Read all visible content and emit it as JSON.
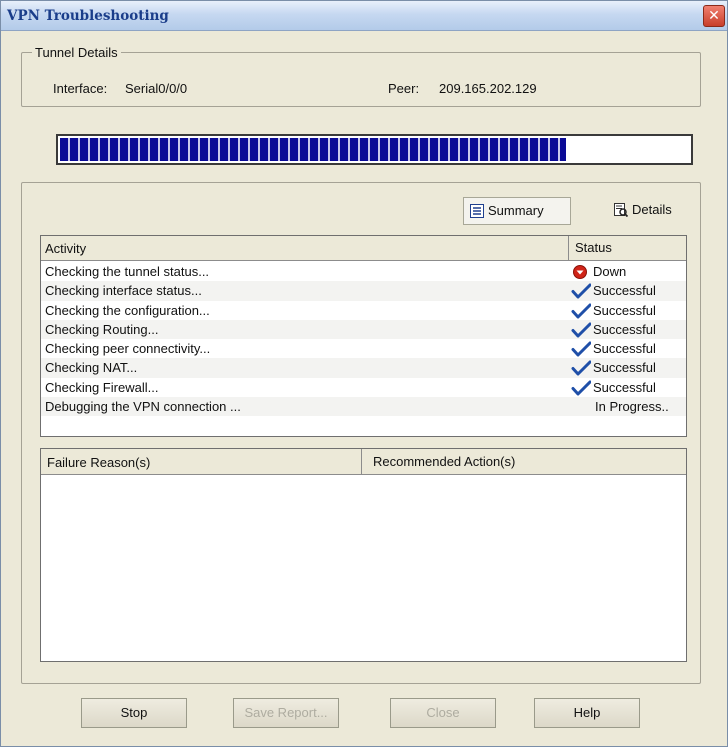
{
  "window": {
    "title": "VPN Troubleshooting",
    "close_glyph": "✕"
  },
  "tunnel_details": {
    "legend": "Tunnel Details",
    "interface_label": "Interface:",
    "interface_value": "Serial0/0/0",
    "peer_label": "Peer:",
    "peer_value": "209.165.202.129"
  },
  "progress": {
    "fraction": 0.805,
    "color": "#0a0a96"
  },
  "view_buttons": {
    "summary_label": "Summary",
    "summary_icon": "list-icon",
    "details_label": "Details",
    "details_icon": "details-icon"
  },
  "activity_table": {
    "headers": {
      "activity": "Activity",
      "status": "Status"
    },
    "rows": [
      {
        "activity": "Checking the tunnel status...",
        "status": "Down",
        "icon": "down-icon"
      },
      {
        "activity": "Checking interface status...",
        "status": "Successful",
        "icon": "checkmark-icon"
      },
      {
        "activity": "Checking the configuration...",
        "status": "Successful",
        "icon": "checkmark-icon"
      },
      {
        "activity": "Checking Routing...",
        "status": "Successful",
        "icon": "checkmark-icon"
      },
      {
        "activity": "Checking peer connectivity...",
        "status": "Successful",
        "icon": "checkmark-icon"
      },
      {
        "activity": "Checking NAT...",
        "status": "Successful",
        "icon": "checkmark-icon"
      },
      {
        "activity": "Checking Firewall...",
        "status": "Successful",
        "icon": "checkmark-icon"
      },
      {
        "activity": "Debugging the VPN connection ...",
        "status": "In Progress..",
        "icon": ""
      }
    ]
  },
  "failure_table": {
    "headers": {
      "failure": "Failure Reason(s)",
      "action": "Recommended Action(s)"
    },
    "rows": []
  },
  "footer": {
    "stop": {
      "label": "Stop",
      "enabled": true
    },
    "save_report": {
      "label": "Save Report...",
      "enabled": false
    },
    "close": {
      "label": "Close",
      "enabled": false
    },
    "help": {
      "label": "Help",
      "enabled": true
    }
  },
  "colors": {
    "down": "#d02418",
    "check": "#1f4fa8",
    "title_text": "#1a3d8a"
  }
}
